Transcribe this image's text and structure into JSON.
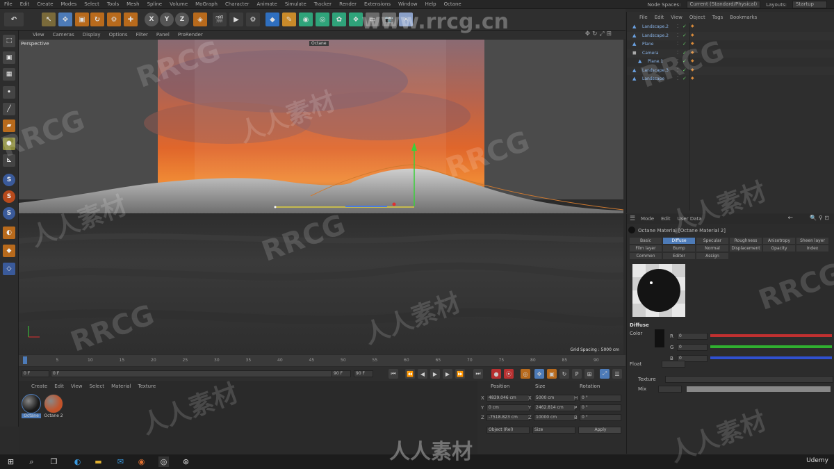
{
  "menu": {
    "items": [
      "File",
      "Edit",
      "Create",
      "Modes",
      "Select",
      "Tools",
      "Mesh",
      "Spline",
      "Volume",
      "MoGraph",
      "Character",
      "Animate",
      "Simulate",
      "Tracker",
      "Render",
      "Extensions",
      "Window",
      "Help",
      "Octane"
    ],
    "node_spaces_label": "Node Spaces:",
    "node_spaces_value": "Current (Standard/Physical)",
    "layouts_label": "Layouts:",
    "layouts_value": "Startup"
  },
  "toolbar": {
    "axis_x": "X",
    "axis_y": "Y",
    "axis_z": "Z"
  },
  "viewport": {
    "menus": [
      "View",
      "Cameras",
      "Display",
      "Options",
      "Filter",
      "Panel",
      "ProRender"
    ],
    "label": "Perspective",
    "handle_label": "Octane",
    "grid_spacing": "Grid Spacing : 5000 cm"
  },
  "timeline": {
    "ticks": [
      "0",
      "5",
      "10",
      "15",
      "20",
      "25",
      "30",
      "35",
      "40",
      "45",
      "50",
      "55",
      "60",
      "65",
      "70",
      "75",
      "80",
      "85",
      "90"
    ],
    "frame_field_left": "0 F",
    "frame_field_mid": "0 F",
    "frame_end_a": "90 F",
    "frame_end_b": "90 F",
    "current_frame": "0 F"
  },
  "materials": {
    "menus": [
      "Create",
      "Edit",
      "View",
      "Select",
      "Material",
      "Texture"
    ],
    "items": [
      {
        "name": "Octane",
        "color": "#1a1a1a"
      },
      {
        "name": "Octane 2",
        "color": "#c2532a"
      }
    ]
  },
  "coordinates": {
    "headers": {
      "position": "Position",
      "size": "Size",
      "rotation": "Rotation"
    },
    "rows": [
      {
        "axis": "X",
        "pos": "4839.046 cm",
        "size": "5000 cm",
        "rot_axis": "H",
        "rot": "0 °"
      },
      {
        "axis": "Y",
        "pos": "0 cm",
        "size": "2462.814 cm",
        "rot_axis": "P",
        "rot": "0 °"
      },
      {
        "axis": "Z",
        "pos": "-7518.823 cm",
        "size": "10000 cm",
        "rot_axis": "B",
        "rot": "0 °"
      }
    ],
    "mode_a": "Object (Rel)",
    "mode_b": "Size",
    "apply": "Apply"
  },
  "object_manager": {
    "menus": [
      "File",
      "Edit",
      "View",
      "Object",
      "Tags",
      "Bookmarks"
    ],
    "objects": [
      {
        "name": "Landscape.2",
        "indent": 0
      },
      {
        "name": "Landscape.2",
        "indent": 0
      },
      {
        "name": "Plane",
        "indent": 0
      },
      {
        "name": "Camera",
        "indent": 0
      },
      {
        "name": "Plane.1",
        "indent": 1
      },
      {
        "name": "Landscape.3",
        "indent": 0
      },
      {
        "name": "Landscape",
        "indent": 0
      }
    ]
  },
  "attributes": {
    "menus": [
      "Mode",
      "Edit",
      "User Data"
    ],
    "title": "Octane Material [Octane Material 2]",
    "tabs_row1": [
      "Basic",
      "Diffuse",
      "Specular",
      "Roughness",
      "Anisotropy",
      "Sheen layer"
    ],
    "tabs_row2": [
      "Film layer",
      "Bump",
      "Normal",
      "Displacement",
      "Opacity",
      "Index"
    ],
    "tabs_row3": [
      "Common",
      "Editor",
      "Assign"
    ],
    "selected_tab": "Diffuse",
    "section": "Diffuse",
    "color_label": "Color",
    "rgb_label_r": "R",
    "rgb_label_g": "G",
    "rgb_label_b": "B",
    "rgb_value": "0",
    "float_label": "Float",
    "texture_label": "Texture",
    "mix_label": "Mix"
  },
  "watermarks": {
    "site": "www.rrcg.cn",
    "brand": "RRCG",
    "cn": "人人素材",
    "udemy": "Udemy"
  }
}
